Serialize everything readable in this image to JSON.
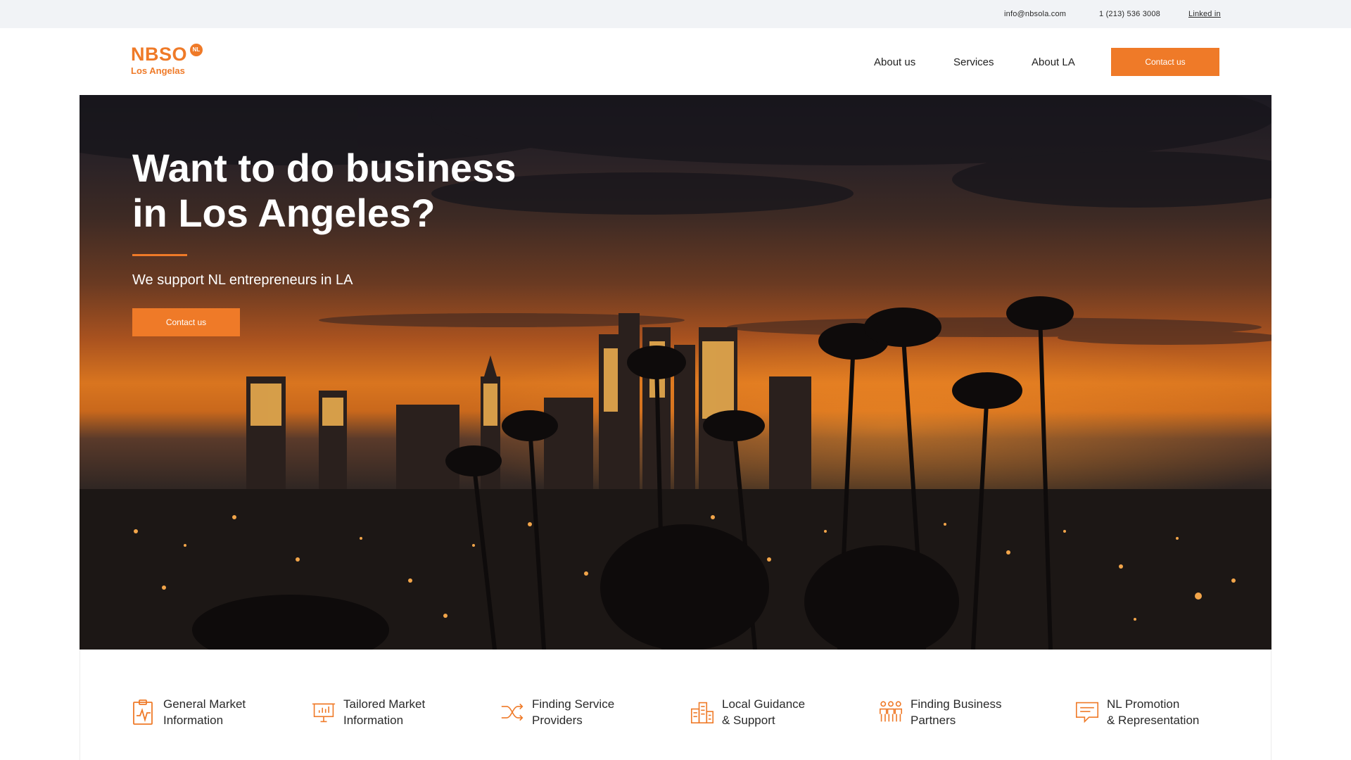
{
  "topbar": {
    "email": "info@nbsola.com",
    "phone": "1 (213) 536 3008",
    "linkedin": "Linked in"
  },
  "header": {
    "logo_main": "NBSO",
    "logo_badge": "NL",
    "logo_sub": "Los Angelas",
    "nav": [
      "About us",
      "Services",
      "About LA"
    ],
    "contact_button": "Contact us"
  },
  "hero": {
    "title_line1": "Want to do business",
    "title_line2": "in Los Angeles?",
    "subtitle": "We support NL entrepreneurs in LA",
    "cta": "Contact us"
  },
  "services": [
    {
      "line1": "General Market",
      "line2": "Information",
      "icon": "clipboard-chart-icon"
    },
    {
      "line1": "Tailored Market",
      "line2": "Information",
      "icon": "presentation-board-icon"
    },
    {
      "line1": "Finding Service",
      "line2": "Providers",
      "icon": "shuffle-arrows-icon"
    },
    {
      "line1": "Local Guidance",
      "line2": "& Support",
      "icon": "buildings-icon"
    },
    {
      "line1": "Finding Business",
      "line2": "Partners",
      "icon": "people-group-icon"
    },
    {
      "line1": "NL Promotion",
      "line2": "& Representation",
      "icon": "chat-bubble-icon"
    }
  ],
  "colors": {
    "accent": "#ef7a28",
    "topbar_bg": "#f1f3f6"
  }
}
